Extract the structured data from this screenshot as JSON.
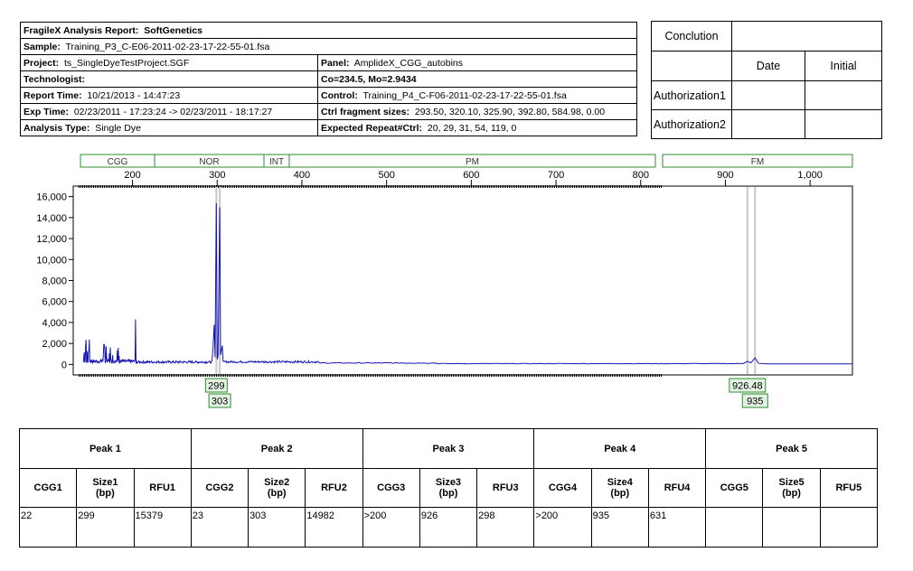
{
  "report": {
    "title_label": "FragileX Analysis Report:",
    "title_value": "SoftGenetics",
    "sample_label": "Sample:",
    "sample_value": "Training_P3_C-E06-2011-02-23-17-22-55-01.fsa",
    "project_label": "Project:",
    "project_value": "ts_SingleDyeTestProject.SGF",
    "panel_label": "Panel:",
    "panel_value": "AmplideX_CGG_autobins",
    "technologist_label": "Technologist:",
    "technologist_value": "",
    "co_mo": "Co=234.5, Mo=2.9434",
    "report_time_label": "Report Time:",
    "report_time_value": "10/21/2013 - 14:47:23",
    "control_label": "Control:",
    "control_value": "Training_P4_C-F06-2011-02-23-17-22-55-01.fsa",
    "exp_time_label": "Exp Time:",
    "exp_time_value": "02/23/2011 - 17:23:24 -> 02/23/2011 - 18:17:27",
    "ctrl_sizes_label": "Ctrl fragment sizes:",
    "ctrl_sizes_value": "293.50, 320.10, 325.90, 392.80, 584.98, 0.00",
    "analysis_type_label": "Analysis Type:",
    "analysis_type_value": "Single Dye",
    "expected_repeat_label": "Expected Repeat#Ctrl:",
    "expected_repeat_value": "20, 29, 31, 54, 119, 0"
  },
  "conclusion": {
    "conclusion_label": "Conclution",
    "date_label": "Date",
    "initial_label": "Initial",
    "auth1_label": "Authorization1",
    "auth2_label": "Authorization2"
  },
  "chart_data": {
    "type": "line",
    "bins": [
      "CGG",
      "NOR",
      "INT",
      "PM",
      "FM"
    ],
    "x_ticks": [
      "200",
      "300",
      "400",
      "500",
      "600",
      "700",
      "800",
      "900",
      "1,000"
    ],
    "x_range": [
      130,
      1050
    ],
    "y_ticks": [
      "16,000",
      "14,000",
      "12,000",
      "10,000",
      "8,000",
      "6,000",
      "4,000",
      "2,000",
      "0"
    ],
    "y_range": [
      -1000,
      17000
    ],
    "series_color": "#1515b5",
    "peak_labels": [
      "299",
      "303",
      "926.48",
      "935"
    ],
    "peaks": [
      {
        "size": 299,
        "rfu": 15379
      },
      {
        "size": 303,
        "rfu": 14982
      },
      {
        "size": 926,
        "rfu": 298
      },
      {
        "size": 935,
        "rfu": 631
      }
    ]
  },
  "peaks_table": {
    "groups": [
      "Peak 1",
      "Peak 2",
      "Peak 3",
      "Peak 4",
      "Peak 5"
    ],
    "columns": [
      "CGG1",
      "Size1\n(bp)",
      "RFU1",
      "CGG2",
      "Size2\n(bp)",
      "RFU2",
      "CGG3",
      "Size3\n(bp)",
      "RFU3",
      "CGG4",
      "Size4\n(bp)",
      "RFU4",
      "CGG5",
      "Size5\n(bp)",
      "RFU5"
    ],
    "values": [
      "22",
      "299",
      "15379",
      "23",
      "303",
      "14982",
      ">200",
      "926",
      "298",
      ">200",
      "935",
      "631",
      "",
      "",
      ""
    ]
  }
}
